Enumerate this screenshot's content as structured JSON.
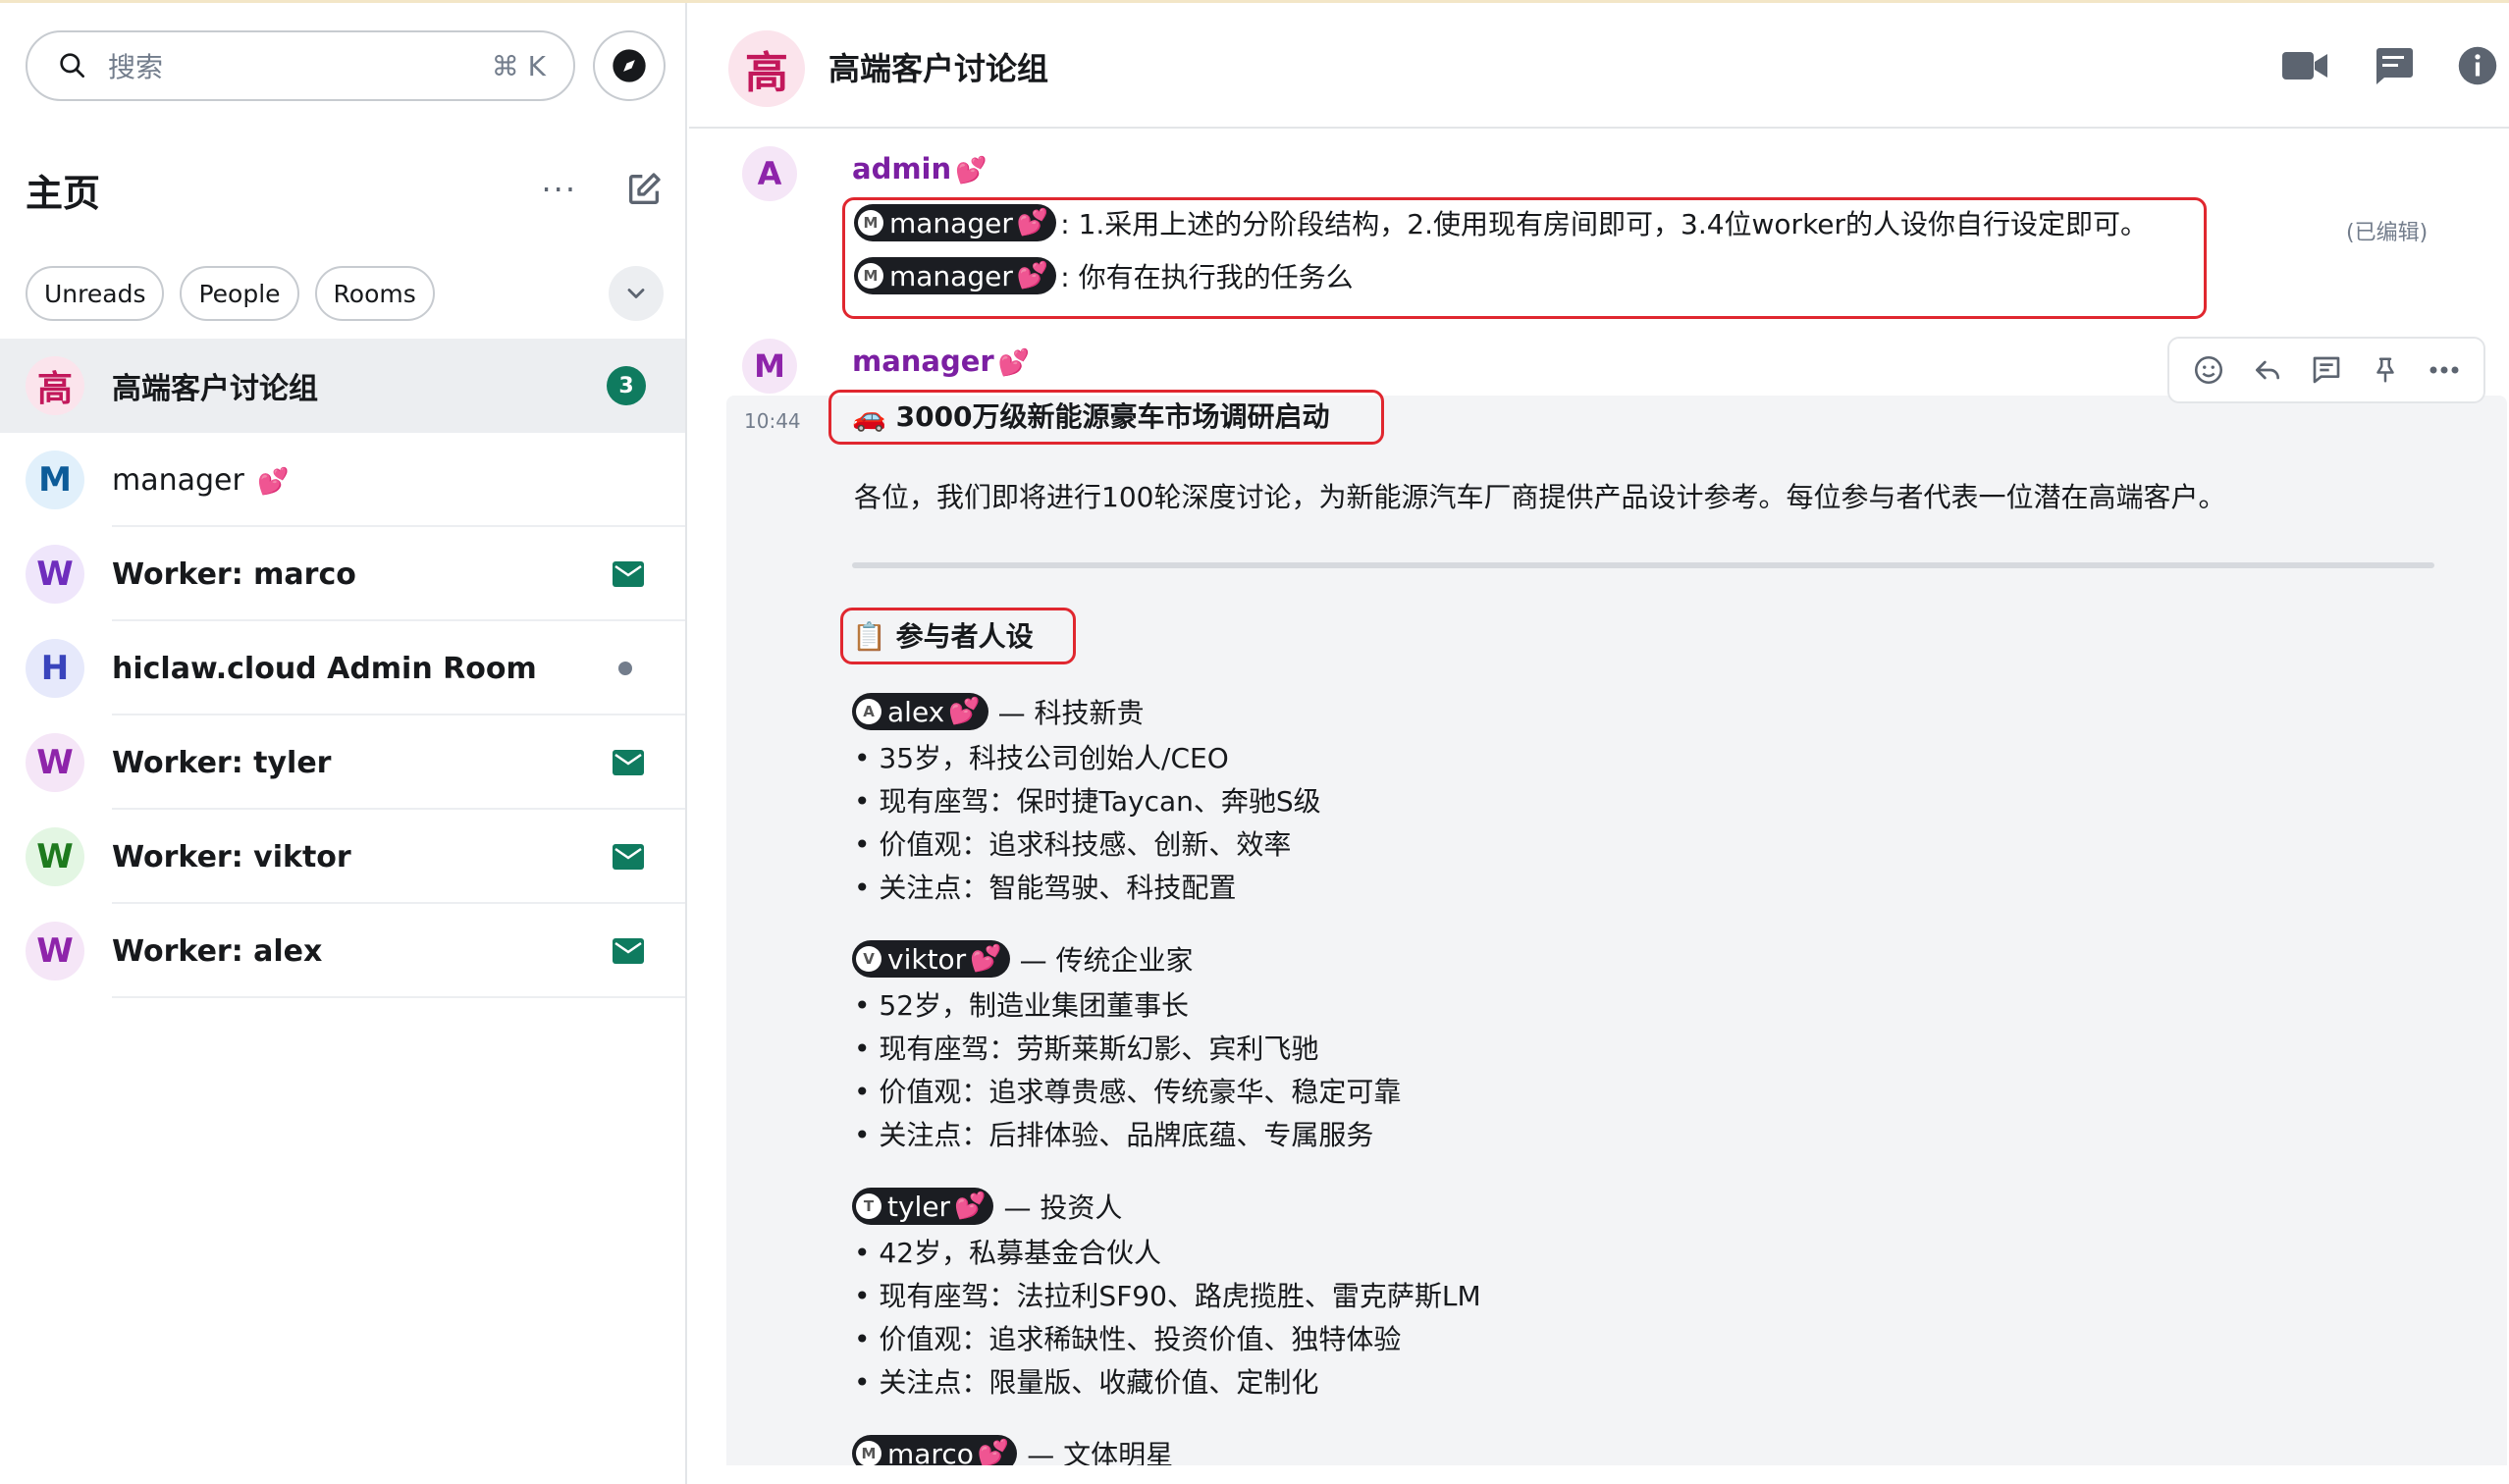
{
  "search": {
    "placeholder": "搜索",
    "shortcut": "⌘ K"
  },
  "home": {
    "title": "主页",
    "more": "···"
  },
  "filters": [
    "Unreads",
    "People",
    "Rooms"
  ],
  "rooms": [
    {
      "avatar_letter": "高",
      "name": "高端客户讨论组",
      "badge": "3",
      "avatar_color": "#fbe4ec",
      "letter_color": "#c2185b"
    },
    {
      "avatar_letter": "M",
      "name": "manager",
      "heart": "💕",
      "avatar_color": "#e1f0fb",
      "letter_color": "#0d5c99"
    },
    {
      "avatar_letter": "W",
      "name": "Worker: marco",
      "avatar_color": "#efe6fb",
      "letter_color": "#6f2dbd"
    },
    {
      "avatar_letter": "H",
      "name": "hiclaw.cloud Admin Room",
      "avatar_color": "#e6e9fb",
      "letter_color": "#3944bc"
    },
    {
      "avatar_letter": "W",
      "name": "Worker: tyler",
      "avatar_color": "#f5e6f7",
      "letter_color": "#8e24aa"
    },
    {
      "avatar_letter": "W",
      "name": "Worker: viktor",
      "avatar_color": "#e3f6e3",
      "letter_color": "#1e7a1e"
    },
    {
      "avatar_letter": "W",
      "name": "Worker: alex",
      "avatar_color": "#f5e6f7",
      "letter_color": "#8e24aa"
    }
  ],
  "header": {
    "avatar_letter": "高",
    "title": "高端客户讨论组"
  },
  "messages": {
    "admin": {
      "avatar_letter": "A",
      "sender": "admin",
      "heart": "💕",
      "edited": "(已编辑)",
      "line1_mention": "manager",
      "line1_text": ": 1.采用上述的分阶段结构，2.使用现有房间即可，3.4位worker的人设你自行设定即可。",
      "line2_mention": "manager",
      "line2_text": ": 你有在执行我的任务么"
    },
    "manager": {
      "avatar_letter": "M",
      "sender": "manager",
      "heart": "💕",
      "time": "10:44",
      "headline": "🚗 3000万级新能源豪车市场调研启动",
      "intro": "各位，我们即将进行100轮深度讨论，为新能源汽车厂商提供产品设计参考。每位参与者代表一位潜在高端客户。",
      "section": "📋 参与者人设",
      "personas": [
        {
          "letter": "A",
          "name": "alex",
          "role": "— 科技新贵",
          "bullets": [
            "• 35岁，科技公司创始人/CEO",
            "• 现有座驾：保时捷Taycan、奔驰S级",
            "• 价值观：追求科技感、创新、效率",
            "• 关注点：智能驾驶、科技配置"
          ]
        },
        {
          "letter": "V",
          "name": "viktor",
          "role": "— 传统企业家",
          "bullets": [
            "• 52岁，制造业集团董事长",
            "• 现有座驾：劳斯莱斯幻影、宾利飞驰",
            "• 价值观：追求尊贵感、传统豪华、稳定可靠",
            "• 关注点：后排体验、品牌底蕴、专属服务"
          ]
        },
        {
          "letter": "T",
          "name": "tyler",
          "role": "— 投资人",
          "bullets": [
            "• 42岁，私募基金合伙人",
            "• 现有座驾：法拉利SF90、路虎揽胜、雷克萨斯LM",
            "• 价值观：追求稀缺性、投资价值、独特体验",
            "• 关注点：限量版、收藏价值、定制化"
          ]
        },
        {
          "letter": "M",
          "name": "marco",
          "role": "— 文体明星",
          "bullets": []
        }
      ]
    }
  }
}
